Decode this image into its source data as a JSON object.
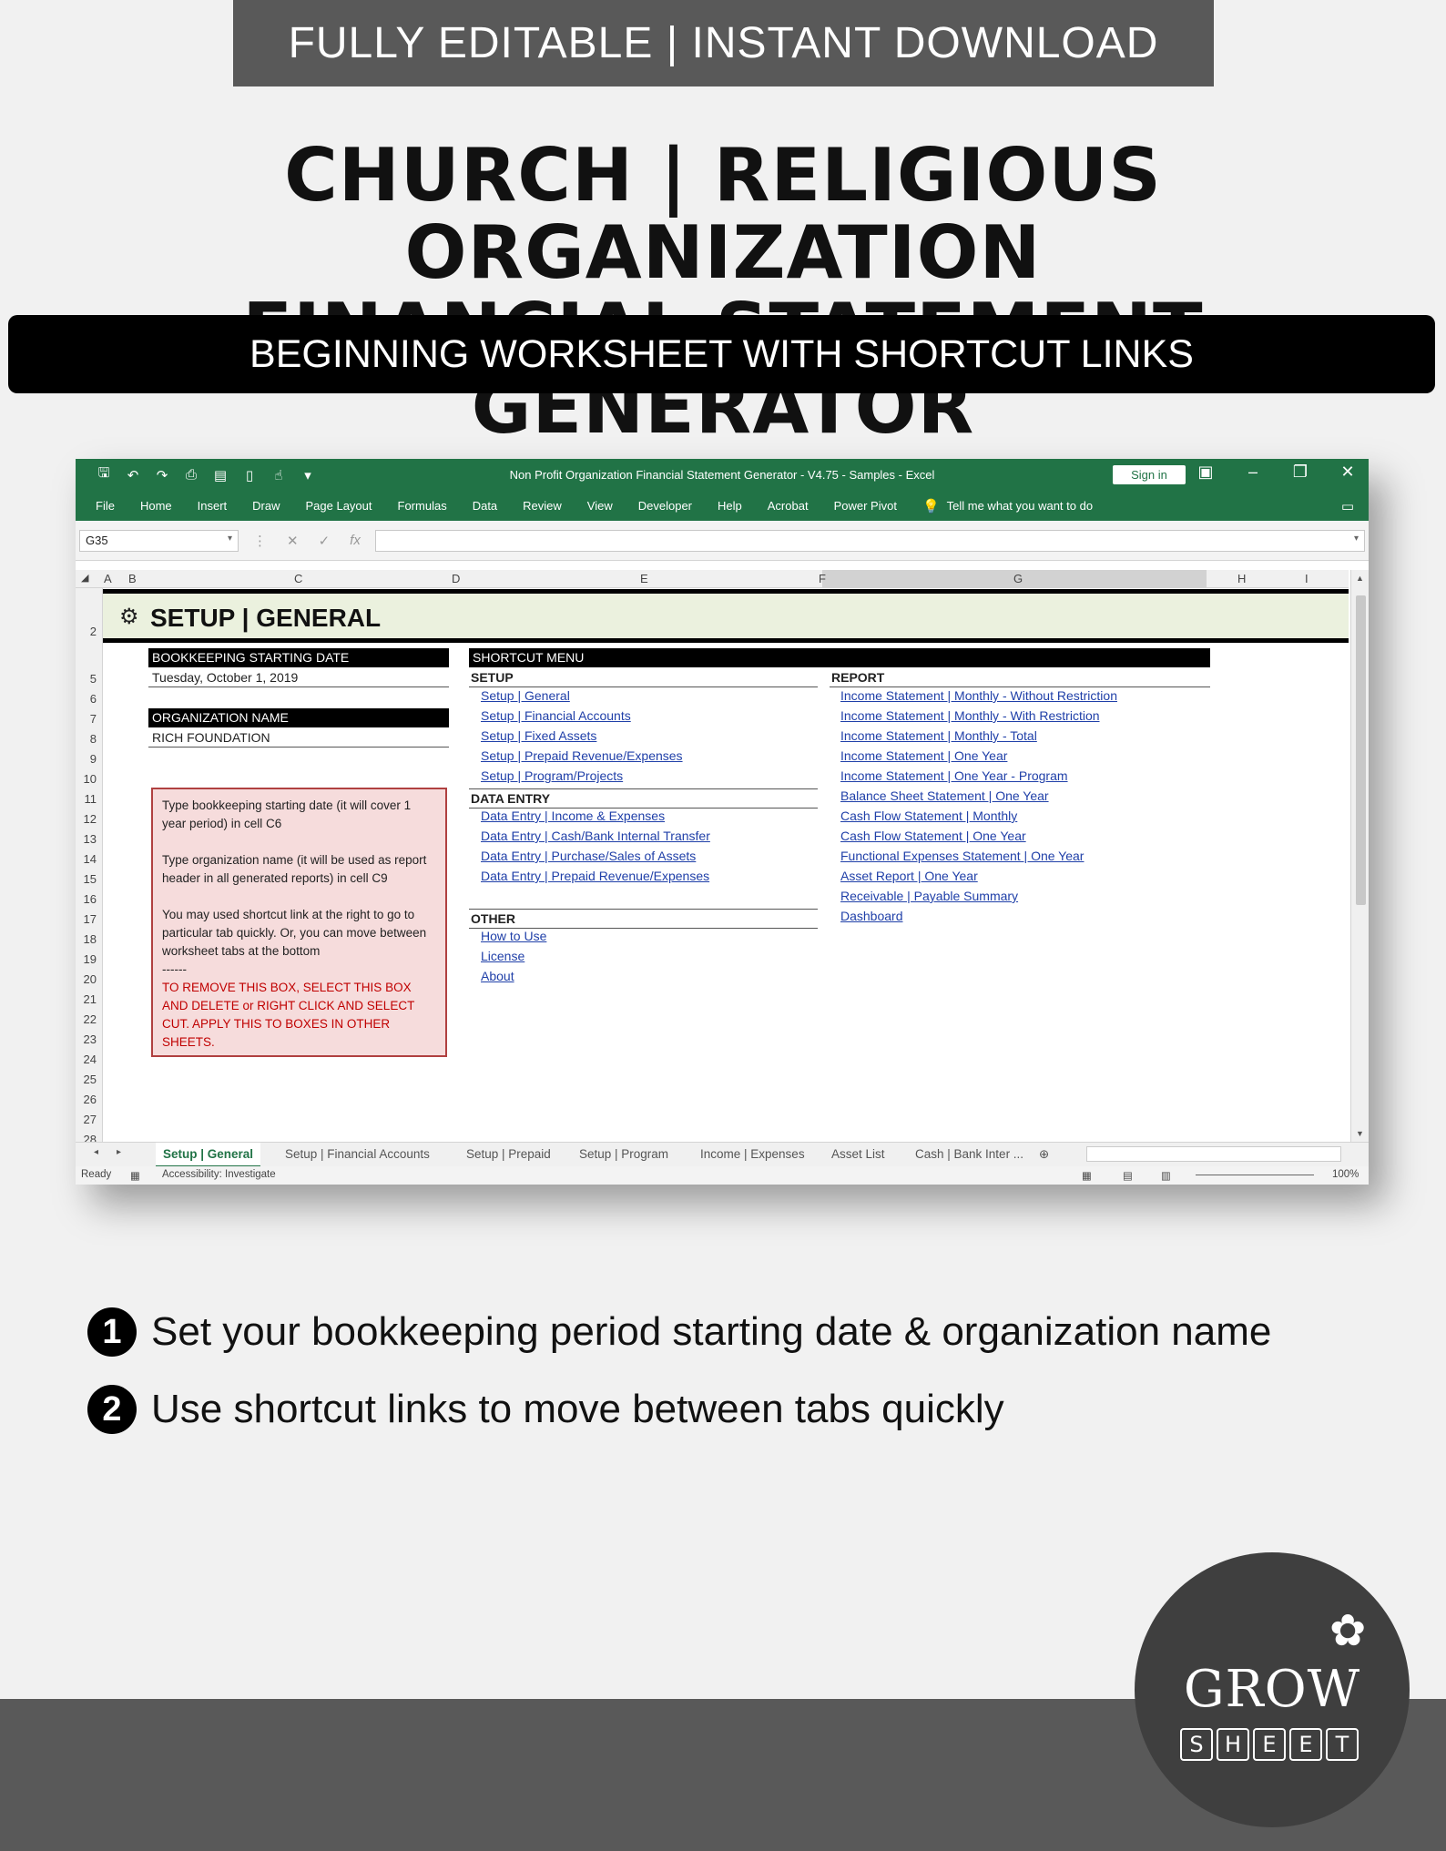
{
  "top_banner": "FULLY EDITABLE | INSTANT DOWNLOAD",
  "title_line1": "CHURCH | RELIGIOUS ORGANIZATION",
  "title_line2": "FINANCIAL STATEMENT GENERATOR",
  "sub_banner": "BEGINNING WORKSHEET WITH SHORTCUT LINKS",
  "excel": {
    "window_title": "Non Profit Organization Financial Statement Generator - V4.75 - Samples  -  Excel",
    "sign_in": "Sign in",
    "ribbon_tabs": [
      "File",
      "Home",
      "Insert",
      "Draw",
      "Page Layout",
      "Formulas",
      "Data",
      "Review",
      "View",
      "Developer",
      "Help",
      "Acrobat",
      "Power Pivot"
    ],
    "tell_me": "Tell me what you want to do",
    "name_box": "G35",
    "columns": [
      "A",
      "B",
      "C",
      "D",
      "E",
      "F",
      "G",
      "H",
      "I"
    ],
    "rows": [
      "2",
      "5",
      "6",
      "7",
      "8",
      "9",
      "10",
      "11",
      "12",
      "13",
      "14",
      "15",
      "16",
      "17",
      "18",
      "19",
      "20",
      "21",
      "22",
      "23",
      "24",
      "25",
      "26",
      "27",
      "28"
    ],
    "sheet_title": "SETUP | GENERAL",
    "bookkeeping_label": "BOOKKEEPING STARTING DATE",
    "bookkeeping_value": "Tuesday, October 1, 2019",
    "org_label": "ORGANIZATION NAME",
    "org_value": "RICH FOUNDATION",
    "note": {
      "p1": "Type bookkeeping starting date (it will cover 1 year period) in cell C6",
      "p2": "Type organization name (it will be used as report header in all generated reports) in cell C9",
      "p3": "You may used shortcut link at the right to go to particular tab quickly. Or, you can move between worksheet tabs at the bottom",
      "sep": "------",
      "warning": "TO REMOVE THIS BOX, SELECT THIS BOX AND DELETE or RIGHT CLICK AND SELECT CUT. APPLY THIS TO BOXES IN OTHER SHEETS."
    },
    "shortcut_menu": "SHORTCUT MENU",
    "setup_hdr": "SETUP",
    "setup_links": [
      "Setup | General",
      "Setup | Financial Accounts",
      "Setup | Fixed Assets",
      "Setup | Prepaid Revenue/Expenses",
      "Setup | Program/Projects"
    ],
    "data_entry_hdr": "DATA ENTRY",
    "data_entry_links": [
      "Data Entry | Income & Expenses",
      "Data Entry | Cash/Bank Internal Transfer",
      "Data Entry | Purchase/Sales of Assets",
      "Data Entry | Prepaid Revenue/Expenses"
    ],
    "other_hdr": "OTHER",
    "other_links": [
      "How to Use",
      "License",
      "About"
    ],
    "report_hdr": "REPORT",
    "report_links": [
      "Income Statement | Monthly - Without Restriction",
      "Income Statement | Monthly - With Restriction",
      "Income Statement | Monthly - Total",
      "Income Statement | One Year",
      "Income Statement | One Year - Program",
      "Balance Sheet Statement | One Year",
      "Cash Flow Statement | Monthly",
      "Cash Flow Statement | One Year",
      "Functional Expenses Statement | One Year",
      "Asset Report | One Year",
      "Receivable | Payable Summary",
      "Dashboard"
    ],
    "sheet_tabs": [
      "Setup | General",
      "Setup | Financial Accounts",
      "Setup | Prepaid",
      "Setup | Program",
      "Income | Expenses",
      "Asset List",
      "Cash | Bank Inter ..."
    ],
    "status_ready": "Ready",
    "status_accessibility": "Accessibility: Investigate",
    "zoom": "100%"
  },
  "bullets": [
    {
      "num": "1",
      "text": "Set your bookkeeping period starting date & organization name"
    },
    {
      "num": "2",
      "text": "Use shortcut links to move between tabs quickly"
    }
  ],
  "logo": {
    "word1": "GROW",
    "letters": [
      "S",
      "H",
      "E",
      "E",
      "T"
    ]
  },
  "colors": {
    "excel_green": "#217346",
    "banner_gray": "#595959",
    "header_band": "#ebf1de",
    "link_blue": "#1f3fa8",
    "note_bg": "#f6dcdc",
    "warning_red": "#c00000"
  }
}
